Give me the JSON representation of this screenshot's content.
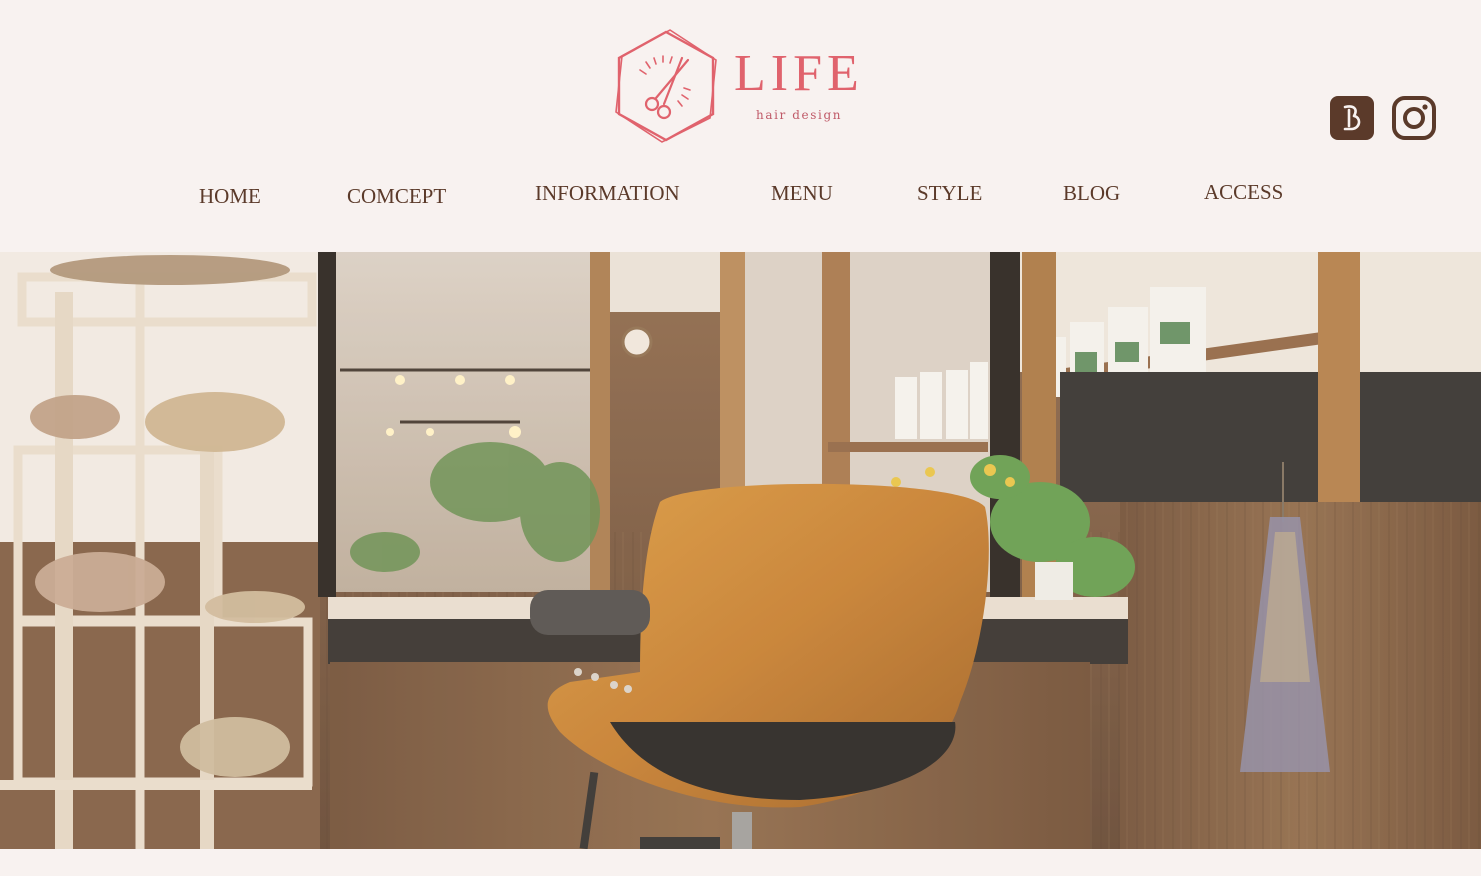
{
  "brand": {
    "name": "LIFE",
    "tagline": "hair design",
    "logo_color": "#e0636d"
  },
  "social": {
    "blog_icon": "ameba-blog-icon",
    "instagram_icon": "instagram-icon",
    "icon_color": "#5b3a2a"
  },
  "nav": {
    "items": [
      {
        "label": "HOME"
      },
      {
        "label": "COMCEPT"
      },
      {
        "label": "INFORMATION"
      },
      {
        "label": "MENU"
      },
      {
        "label": "STYLE"
      },
      {
        "label": "BLOG"
      },
      {
        "label": "ACCESS"
      }
    ],
    "text_color": "#5b3a2a"
  },
  "hero": {
    "image": "hair salon interior with wooden styling chair, mirror, shelves with dried flowers"
  },
  "colors": {
    "background": "#f8f2f0",
    "accent": "#e0636d",
    "text": "#5b3a2a"
  }
}
